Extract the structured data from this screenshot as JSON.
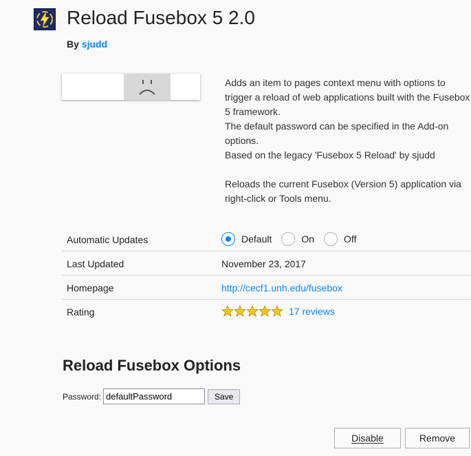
{
  "addon": {
    "title": "Reload Fusebox 5 2.0",
    "by_label": "By",
    "author": "sjudd",
    "description_lines": [
      "Adds an item to pages context menu with options to trigger a reload of web applications built with the Fusebox 5 framework.\nThe default password can be specified in the Add-on options.\nBased on the legacy 'Fusebox 5 Reload' by sjudd",
      "Reloads the current Fusebox (Version 5) application via right-click or Tools menu."
    ]
  },
  "details": {
    "automatic_updates": {
      "label": "Automatic Updates",
      "options": [
        "Default",
        "On",
        "Off"
      ],
      "selected": "Default"
    },
    "last_updated": {
      "label": "Last Updated",
      "value": "November 23, 2017"
    },
    "homepage": {
      "label": "Homepage",
      "value": "http://cecf1.unh.edu/fusebox"
    },
    "rating": {
      "label": "Rating",
      "stars": 5,
      "reviews": "17 reviews"
    }
  },
  "options": {
    "title": "Reload Fusebox Options",
    "password_label": "Password:",
    "password_value": "defaultPassword",
    "save_label": "Save"
  },
  "actions": {
    "disable_label": "Disable",
    "remove_label": "Remove"
  },
  "colors": {
    "accent": "#0a84ff",
    "star": "#f5c518",
    "icon_bg": "#1c2a6b"
  }
}
